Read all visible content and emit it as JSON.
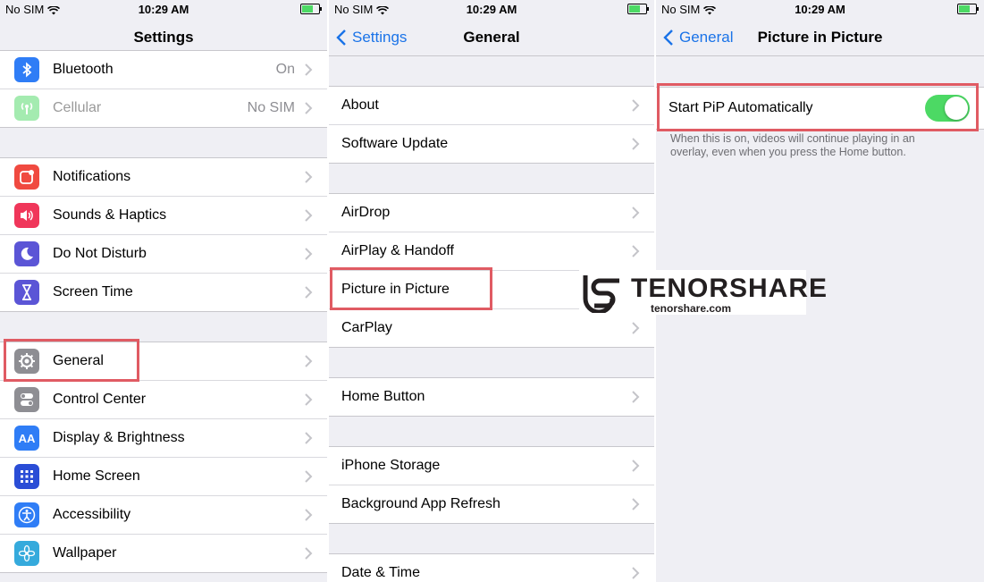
{
  "status": {
    "carrier": "No SIM",
    "time": "10:29 AM"
  },
  "panel1": {
    "title": "Settings",
    "group1": [
      {
        "label": "Bluetooth",
        "value": "On",
        "icon": "bluetooth-icon"
      },
      {
        "label": "Cellular",
        "value": "No SIM",
        "icon": "cellular-icon"
      }
    ],
    "group2": [
      {
        "label": "Notifications",
        "icon": "notifications-icon"
      },
      {
        "label": "Sounds & Haptics",
        "icon": "speaker-icon"
      },
      {
        "label": "Do Not Disturb",
        "icon": "moon-icon"
      },
      {
        "label": "Screen Time",
        "icon": "hourglass-icon"
      }
    ],
    "group3": [
      {
        "label": "General",
        "icon": "gear-icon"
      },
      {
        "label": "Control Center",
        "icon": "toggles-icon"
      },
      {
        "label": "Display & Brightness",
        "icon": "text-size-icon",
        "glyph": "AA"
      },
      {
        "label": "Home Screen",
        "icon": "app-grid-icon"
      },
      {
        "label": "Accessibility",
        "icon": "accessibility-icon"
      },
      {
        "label": "Wallpaper",
        "icon": "flower-icon"
      }
    ]
  },
  "panel2": {
    "back": "Settings",
    "title": "General",
    "group1": [
      "About",
      "Software Update"
    ],
    "group2": [
      "AirDrop",
      "AirPlay & Handoff",
      "Picture in Picture",
      "CarPlay"
    ],
    "group3": [
      "Home Button"
    ],
    "group4": [
      "iPhone Storage",
      "Background App Refresh"
    ],
    "group5": [
      "Date & Time"
    ]
  },
  "panel3": {
    "back": "General",
    "title": "Picture in Picture",
    "toggle_label": "Start PiP Automatically",
    "toggle_on": true,
    "footnote": "When this is on, videos will continue playing in an overlay, even when you press the Home button."
  },
  "watermark": {
    "name": "TENORSHARE",
    "url": "tenorshare.com"
  },
  "colors": {
    "highlight": "#e05b63",
    "accent": "#1a73e8",
    "toggle": "#4cd964"
  }
}
